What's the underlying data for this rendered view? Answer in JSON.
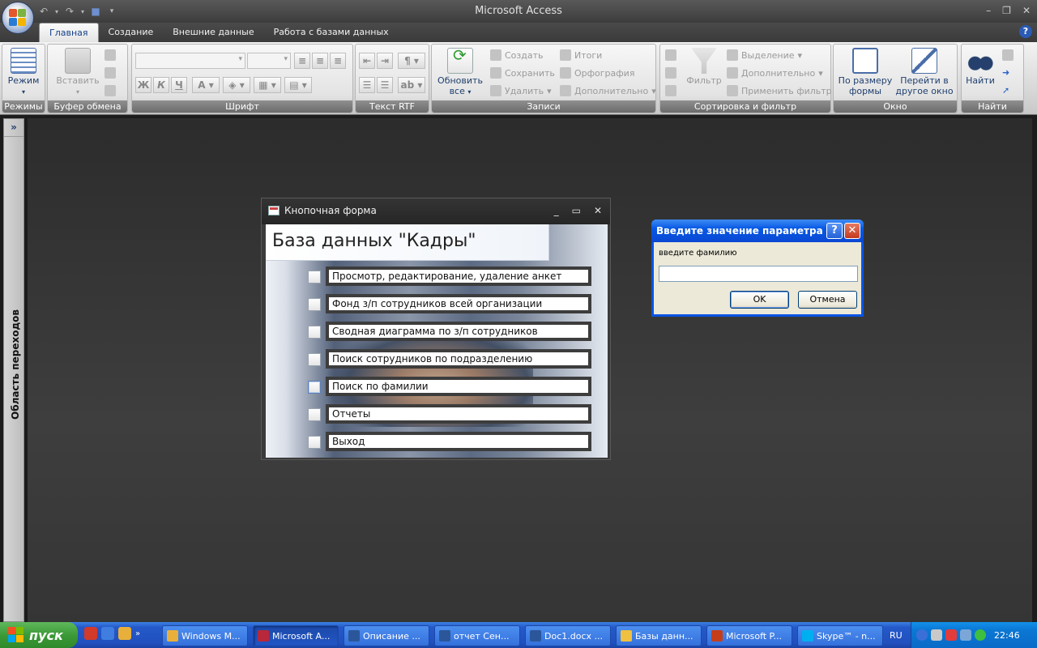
{
  "app": {
    "title": "Microsoft Access"
  },
  "ribbon_tabs": [
    {
      "label": "Главная",
      "active": true
    },
    {
      "label": "Создание",
      "active": false
    },
    {
      "label": "Внешние данные",
      "active": false
    },
    {
      "label": "Работа с базами данных",
      "active": false
    }
  ],
  "ribbon": {
    "groups": {
      "modes": "Режимы",
      "clipboard": "Буфер обмена",
      "font": "Шрифт",
      "rtf": "Текст RTF",
      "records": "Записи",
      "sort_filter": "Сортировка и фильтр",
      "window": "Окно",
      "find": "Найти"
    },
    "view_label": "Режим",
    "paste_label": "Вставить",
    "bold": "Ж",
    "italic": "К",
    "underline": "Ч",
    "refresh_label1": "Обновить",
    "refresh_label2": "все",
    "new_label": "Создать",
    "save_label": "Сохранить",
    "delete_label": "Удалить",
    "totals_label": "Итоги",
    "spelling_label": "Орфография",
    "more_label": "Дополнительно",
    "filter_label": "Фильтр",
    "selection_label": "Выделение",
    "advanced_label": "Дополнительно",
    "toggle_filter_label": "Применить фильтр",
    "fit_form_label1": "По размеру",
    "fit_form_label2": "формы",
    "switch_window_label1": "Перейти в",
    "switch_window_label2": "другое окно",
    "find_label": "Найти"
  },
  "nav_pane": {
    "label": "Область переходов"
  },
  "switchboard": {
    "window_title": "Кнопочная форма",
    "header": "База данных \"Кадры\"",
    "items": [
      "Просмотр, редактирование, удаление анкет",
      "Фонд з/п сотрудников всей организации",
      "Сводная диаграмма по з/п сотрудников",
      "Поиск сотрудников по подразделению",
      "Поиск по фамилии",
      "Отчеты",
      "Выход"
    ],
    "focused_index": 4
  },
  "dialog": {
    "title": "Введите значение параметра",
    "prompt": "введите фамилию",
    "input_value": "",
    "ok": "OK",
    "cancel": "Отмена"
  },
  "taskbar": {
    "start": "пуск",
    "buttons": [
      {
        "label": "Windows M...",
        "color": "#e8b03a"
      },
      {
        "label": "Microsoft A...",
        "color": "#b8283a",
        "active": true
      },
      {
        "label": "Описание ...",
        "color": "#2b579a"
      },
      {
        "label": "отчет Сен...",
        "color": "#2b579a"
      },
      {
        "label": "Doc1.docx ...",
        "color": "#2b579a"
      },
      {
        "label": "Базы данн...",
        "color": "#f0c040"
      },
      {
        "label": "Microsoft P...",
        "color": "#c43e1c"
      },
      {
        "label": "Skype™ - n...",
        "color": "#00aff0"
      }
    ],
    "language": "RU",
    "clock": "22:46"
  },
  "colors": {
    "accent": "#15428b",
    "xp_title": "#0658e5",
    "taskbar": "#2459c9"
  }
}
